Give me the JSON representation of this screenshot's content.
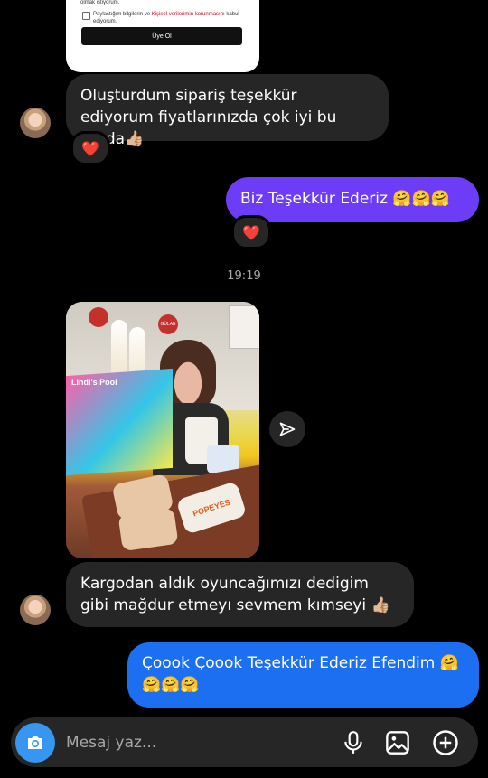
{
  "signup_card": {
    "line_top": "olmak istiyorum.",
    "consent_prefix": "Paylaştığım bilgilerin ve",
    "consent_link": "Kişisel verilerimin korunmasını",
    "consent_suffix": "kabul ediyorum.",
    "button_label": "Üye Ol"
  },
  "messages": [
    {
      "side": "in",
      "text": "Oluşturdum sipariş teşekkür ediyorum fiyatlarınızda çok iyi bu arada👍🏼",
      "reaction": "❤️"
    },
    {
      "side": "out",
      "text": "Biz Teşekkür Ederiz 🤗🤗🤗",
      "reaction": "❤️"
    },
    {
      "side": "in",
      "text": "Kargodan aldık oyuncağımızı dedigim gibi mağdur etmeyı sevmem kımseyi 👍🏼"
    },
    {
      "side": "out",
      "text": "Çoook Çoook Teşekkür Ederiz Efendim 🤗 🤗🤗🤗"
    }
  ],
  "timestamp": "19:19",
  "photo_labels": {
    "box_title": "Lindi's Pool",
    "bag_label": "POPEYES",
    "badge": "GÜLAB"
  },
  "composer": {
    "placeholder": "Mesaj yaz..."
  },
  "colors": {
    "incoming_bubble": "#262626",
    "outgoing_purple": "#6d3cf6",
    "outgoing_blue": "#1d6ff2",
    "camera_button": "#3797f0"
  },
  "icons": {
    "camera": "camera-icon",
    "microphone": "microphone-icon",
    "gallery": "image-icon",
    "add": "plus-circle-icon",
    "share": "send-icon"
  }
}
